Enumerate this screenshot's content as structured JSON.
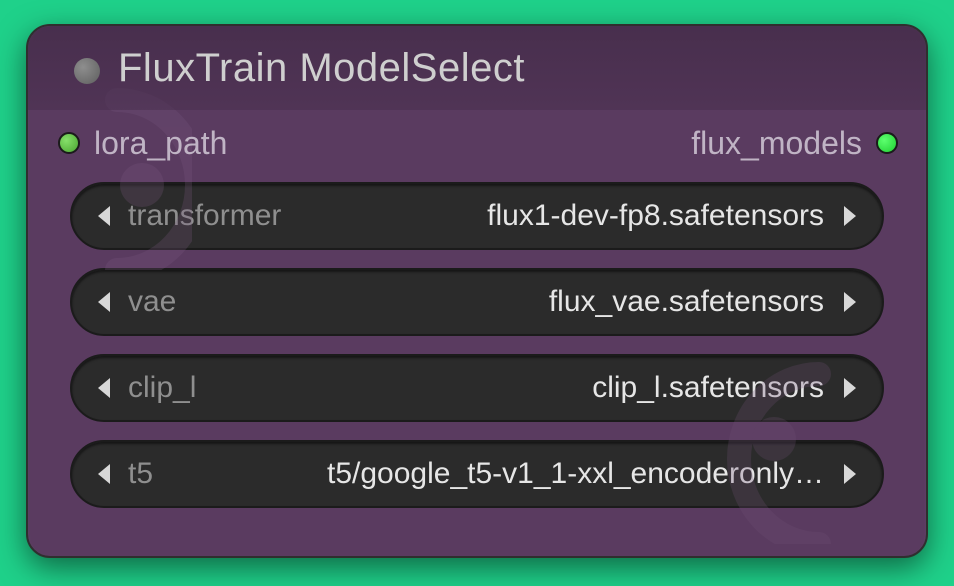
{
  "node": {
    "title": "FluxTrain ModelSelect",
    "inputs": [
      {
        "name": "lora_path"
      }
    ],
    "outputs": [
      {
        "name": "flux_models"
      }
    ],
    "widgets": [
      {
        "name": "transformer",
        "value": "flux1-dev-fp8.safetensors"
      },
      {
        "name": "vae",
        "value": "flux_vae.safetensors"
      },
      {
        "name": "clip_l",
        "value": "clip_l.safetensors"
      },
      {
        "name": "t5",
        "value": "t5/google_t5-v1_1-xxl_encoderonly…"
      }
    ]
  },
  "colors": {
    "canvas_bg": "#1fd18a",
    "node_bg": "#5a3b60",
    "widget_bg": "#2b2b2b"
  }
}
